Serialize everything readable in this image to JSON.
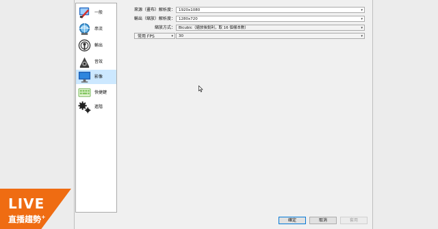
{
  "sidebar": {
    "items": [
      {
        "label": "一般",
        "icon": "general-icon",
        "selected": false
      },
      {
        "label": "串流",
        "icon": "stream-icon",
        "selected": false
      },
      {
        "label": "輸出",
        "icon": "output-icon",
        "selected": false
      },
      {
        "label": "音效",
        "icon": "audio-icon",
        "selected": false
      },
      {
        "label": "影像",
        "icon": "video-icon",
        "selected": true
      },
      {
        "label": "快捷鍵",
        "icon": "hotkeys-icon",
        "selected": false
      },
      {
        "label": "進階",
        "icon": "advanced-icon",
        "selected": false
      }
    ]
  },
  "video": {
    "base_resolution": {
      "label": "來源（畫布）解析度：",
      "value": "1920x1080"
    },
    "output_resolution": {
      "label": "輸出（縮放）解析度：",
      "value": "1280x720"
    },
    "downscale_filter": {
      "label": "縮放方式：",
      "value": "Bicubic（縮放後銳利，取 16 個樣本數）"
    },
    "fps": {
      "type_label": "常用 FPS",
      "value": "30"
    }
  },
  "buttons": {
    "ok": "確定",
    "cancel": "取消",
    "apply": "套用"
  },
  "badge": {
    "title": "LIVE",
    "subtitle": "直播趨勢",
    "plus": "+"
  },
  "colors": {
    "selected_bg": "#cce8ff",
    "badge_orange": "#ef6c12",
    "default_button_border": "#0078d7"
  }
}
